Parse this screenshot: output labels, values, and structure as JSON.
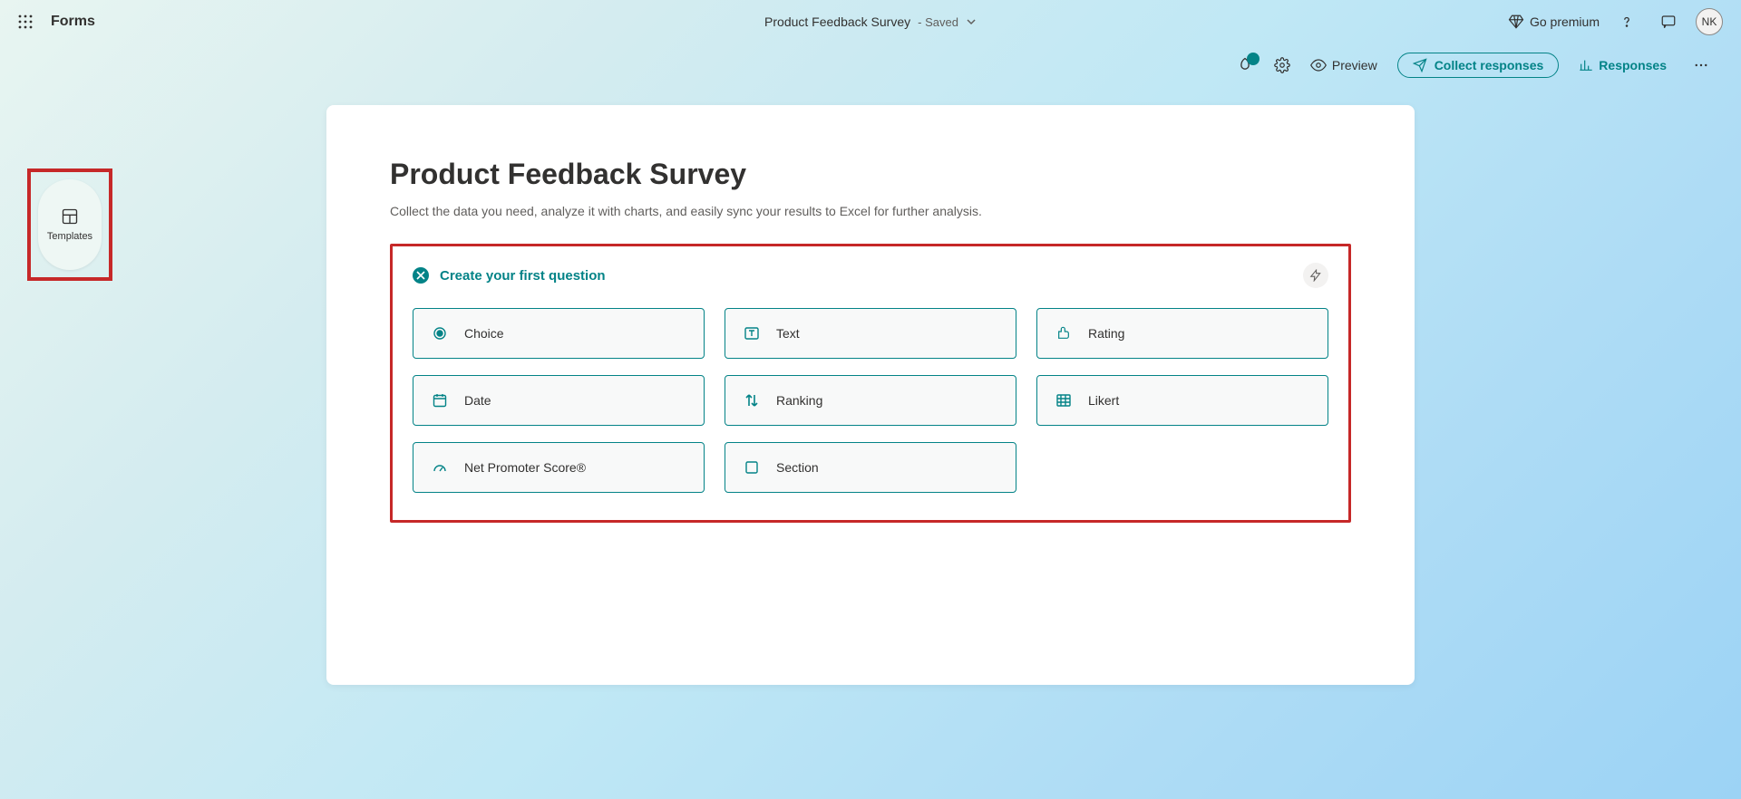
{
  "header": {
    "app_name": "Forms",
    "doc_title": "Product Feedback Survey",
    "doc_status": "Saved",
    "go_premium": "Go premium",
    "avatar_initials": "NK"
  },
  "toolbar": {
    "preview": "Preview",
    "collect": "Collect responses",
    "responses": "Responses"
  },
  "sidebar": {
    "templates_label": "Templates"
  },
  "form": {
    "title": "Product Feedback Survey",
    "description": "Collect the data you need, analyze it with charts, and easily sync your results to Excel for further analysis.",
    "create_heading": "Create your first question",
    "types": {
      "choice": "Choice",
      "text": "Text",
      "rating": "Rating",
      "date": "Date",
      "ranking": "Ranking",
      "likert": "Likert",
      "nps": "Net Promoter Score®",
      "section": "Section"
    }
  }
}
